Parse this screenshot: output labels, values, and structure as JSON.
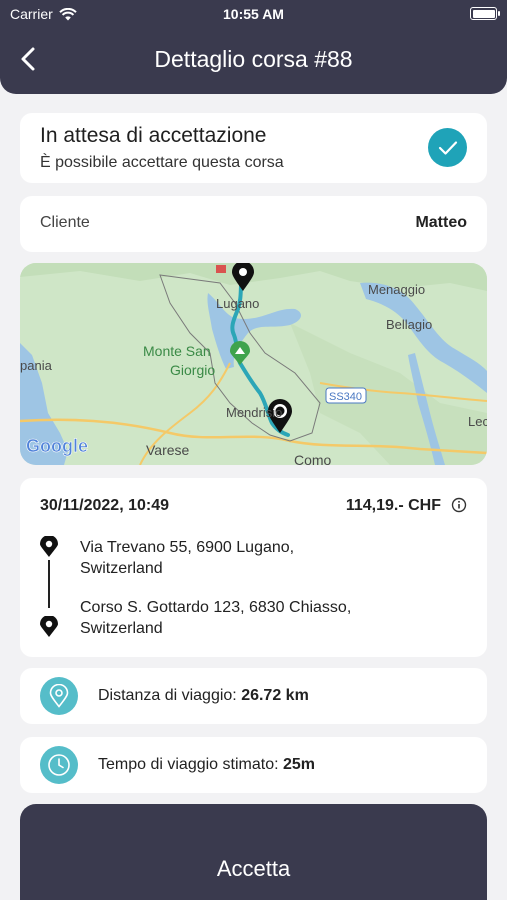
{
  "status_bar": {
    "carrier": "Carrier",
    "time": "10:55 AM"
  },
  "header": {
    "title": "Dettaglio corsa #88"
  },
  "status": {
    "title": "In attesa di accettazione",
    "subtitle": "È possibile accettare questa corsa"
  },
  "client": {
    "label": "Cliente",
    "value": "Matteo"
  },
  "map": {
    "labels": [
      "Lugano",
      "Menaggio",
      "Bellagio",
      "Monte San",
      "Giorgio",
      "Mendrisio",
      "Varese",
      "Como",
      "SS340",
      "pania",
      "Lec"
    ],
    "logo": "Google",
    "colors": {
      "land": "#cfe6c7",
      "water": "#9ec5e4",
      "route": "#2ba6b7",
      "road": "#f4c968"
    }
  },
  "trip": {
    "datetime": "30/11/2022, 10:49",
    "price": "114,19.- CHF",
    "from_line1": "Via Trevano 55, 6900 Lugano,",
    "from_line2": "Switzerland",
    "to_line1": "Corso S. Gottardo 123, 6830 Chiasso,",
    "to_line2": "Switzerland"
  },
  "distance": {
    "label": "Distanza di viaggio: ",
    "value": "26.72 km"
  },
  "duration": {
    "label": "Tempo di viaggio stimato: ",
    "value": "25m"
  },
  "actions": {
    "accept_label": "Accetta"
  },
  "icons": {
    "back": "chevron-left-icon",
    "check": "check-icon",
    "info": "info-icon",
    "pin": "map-pin-icon",
    "location": "location-pin-icon",
    "clock": "clock-icon"
  },
  "theme": {
    "header_bg": "#3a3a4e",
    "accent": "#1fa3b8",
    "icon_bg": "#55bdc9",
    "page_bg": "#f2f2f4"
  }
}
